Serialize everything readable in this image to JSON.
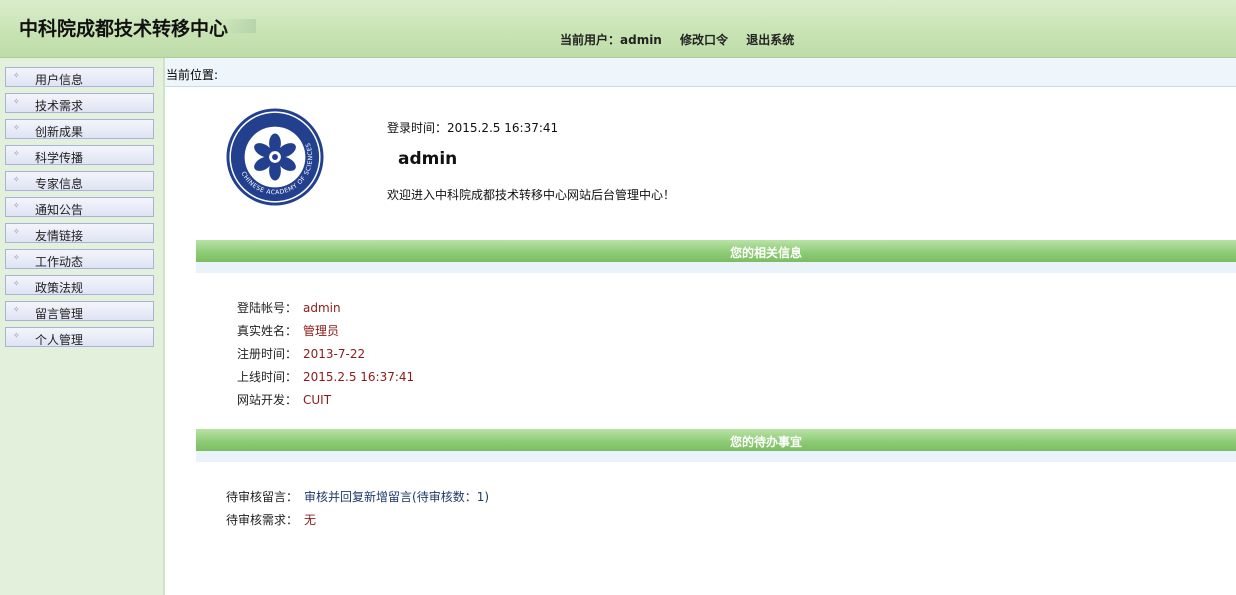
{
  "header": {
    "site_title": "中科院成都技术转移中心",
    "current_user_label": "当前用户：admin",
    "change_password": "修改口令",
    "logout": "退出系统"
  },
  "sidebar": {
    "items": [
      {
        "label": "用户信息"
      },
      {
        "label": "技术需求"
      },
      {
        "label": "创新成果"
      },
      {
        "label": "科学传播"
      },
      {
        "label": "专家信息"
      },
      {
        "label": "通知公告"
      },
      {
        "label": "友情链接"
      },
      {
        "label": "工作动态"
      },
      {
        "label": "政策法规"
      },
      {
        "label": "留言管理"
      },
      {
        "label": "个人管理"
      }
    ]
  },
  "breadcrumb": {
    "label": "当前位置:"
  },
  "welcome": {
    "login_time": "登录时间：2015.2.5 16:37:41",
    "username": "admin",
    "message": "欢迎进入中科院成都技术转移中心网站后台管理中心！"
  },
  "info_section": {
    "title": "您的相关信息",
    "rows": [
      {
        "label": "登陆帐号：",
        "value": "admin"
      },
      {
        "label": "真实姓名：",
        "value": "管理员"
      },
      {
        "label": "注册时间：",
        "value": "2013-7-22"
      },
      {
        "label": "上线时间：",
        "value": "2015.2.5 16:37:41"
      },
      {
        "label": "网站开发：",
        "value": "CUIT"
      }
    ]
  },
  "todo_section": {
    "title": "您的待办事宜",
    "rows": [
      {
        "label": "待审核留言：",
        "value": "审核并回复新增留言(待审核数：1)"
      },
      {
        "label": "待审核需求：",
        "value": "无"
      }
    ]
  },
  "colors": {
    "header_green": "#c7e3b2",
    "sidebar_bg": "#e3f0db",
    "section_green": "#8fcc77",
    "value_red": "#8b1a1a",
    "logo_blue": "#23408e"
  },
  "logo": {
    "ring_text": "CHINESE ACADEMY OF SCIENCES"
  }
}
